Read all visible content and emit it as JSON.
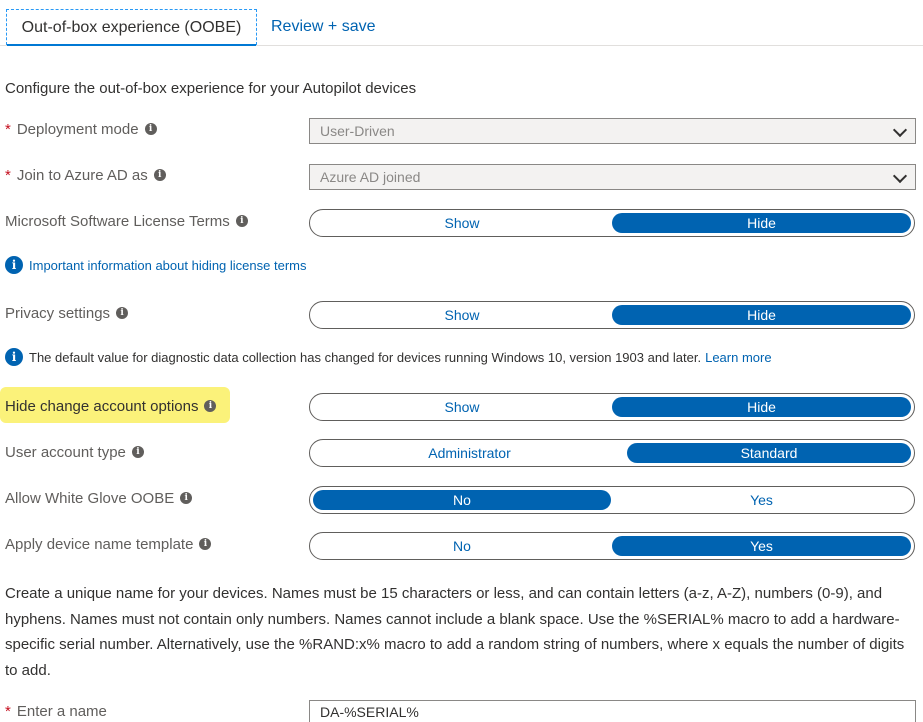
{
  "tabs": {
    "active": "Out-of-box experience (OOBE)",
    "review": "Review + save"
  },
  "intro": "Configure the out-of-box experience for your Autopilot devices",
  "deployment_mode": {
    "label": "Deployment mode",
    "value": "User-Driven"
  },
  "join_azure": {
    "label": "Join to Azure AD as",
    "value": "Azure AD joined"
  },
  "license_terms": {
    "label": "Microsoft Software License Terms",
    "options": [
      "Show",
      "Hide"
    ],
    "selected": "Hide"
  },
  "license_info": "Important information about hiding license terms",
  "privacy": {
    "label": "Privacy settings",
    "options": [
      "Show",
      "Hide"
    ],
    "selected": "Hide"
  },
  "diagnostic_info": {
    "text": "The default value for diagnostic data collection has changed for devices running Windows 10, version 1903 and later.",
    "link": "Learn more"
  },
  "change_account": {
    "label": "Hide change account options",
    "options": [
      "Show",
      "Hide"
    ],
    "selected": "Hide"
  },
  "account_type": {
    "label": "User account type",
    "options": [
      "Administrator",
      "Standard"
    ],
    "selected": "Standard"
  },
  "white_glove": {
    "label": "Allow White Glove OOBE",
    "options": [
      "No",
      "Yes"
    ],
    "selected": "No"
  },
  "device_name_template": {
    "label": "Apply device name template",
    "options": [
      "No",
      "Yes"
    ],
    "selected": "Yes"
  },
  "name_description": "Create a unique name for your devices. Names must be 15 characters or less, and can contain letters (a-z, A-Z), numbers (0-9), and hyphens. Names must not contain only numbers. Names cannot include a blank space. Use the %SERIAL% macro to add a hardware-specific serial number. Alternatively, use the %RAND:x% macro to add a random string of numbers, where x equals the number of digits to add.",
  "enter_name": {
    "label": "Enter a name",
    "value": "DA-%SERIAL%"
  },
  "icons": {
    "info_small": "i",
    "info_circle": "i",
    "required_mark": "*"
  },
  "colors": {
    "accent": "#0063b1",
    "highlight": "#fbf27a",
    "required": "#c50f1f"
  }
}
